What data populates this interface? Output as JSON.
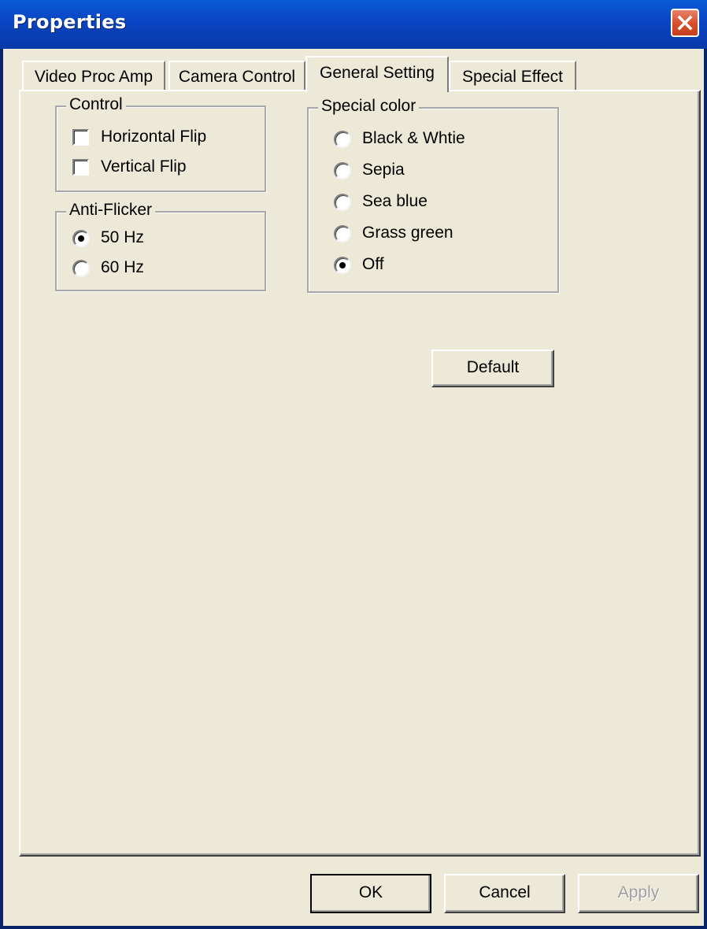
{
  "window": {
    "title": "Properties"
  },
  "tabs": [
    {
      "label": "Video Proc Amp",
      "active": false
    },
    {
      "label": "Camera Control",
      "active": false
    },
    {
      "label": "General Setting",
      "active": true
    },
    {
      "label": "Special Effect",
      "active": false
    }
  ],
  "control_group": {
    "legend": "Control",
    "options": [
      {
        "label": "Horizontal Flip",
        "checked": false
      },
      {
        "label": "Vertical Flip",
        "checked": false
      }
    ]
  },
  "antiflicker_group": {
    "legend": "Anti-Flicker",
    "options": [
      {
        "label": "50 Hz",
        "selected": true
      },
      {
        "label": "60 Hz",
        "selected": false
      }
    ]
  },
  "special_color_group": {
    "legend": "Special color",
    "options": [
      {
        "label": "Black & Whtie",
        "selected": false
      },
      {
        "label": "Sepia",
        "selected": false
      },
      {
        "label": "Sea blue",
        "selected": false
      },
      {
        "label": "Grass green",
        "selected": false
      },
      {
        "label": "Off",
        "selected": true
      }
    ]
  },
  "buttons": {
    "default_label": "Default",
    "ok_label": "OK",
    "cancel_label": "Cancel",
    "apply_label": "Apply",
    "apply_enabled": false
  },
  "colors": {
    "titlebar": "#0a44c2",
    "dialog_bg": "#ece9d8",
    "close_button": "#d9512f"
  },
  "icons": {
    "close": "close-x-icon"
  }
}
